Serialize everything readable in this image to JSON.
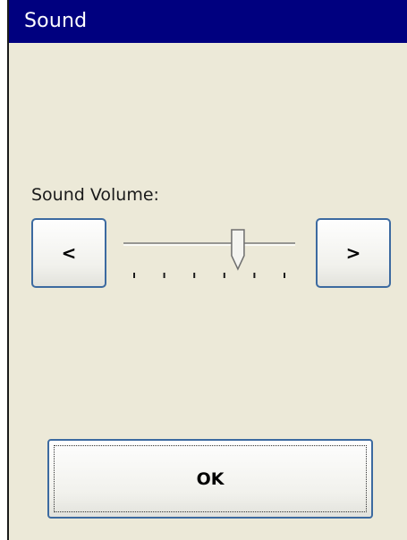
{
  "window": {
    "title": "Sound"
  },
  "volume": {
    "label": "Sound Volume:",
    "decrease_label": "<",
    "increase_label": ">",
    "level_fraction": 0.69,
    "tick_count": 6
  },
  "ok_button": {
    "label": "OK"
  },
  "colors": {
    "titlebar": "#00007f",
    "window_bg": "#ece9d8",
    "button_border": "#3c6aa0"
  }
}
